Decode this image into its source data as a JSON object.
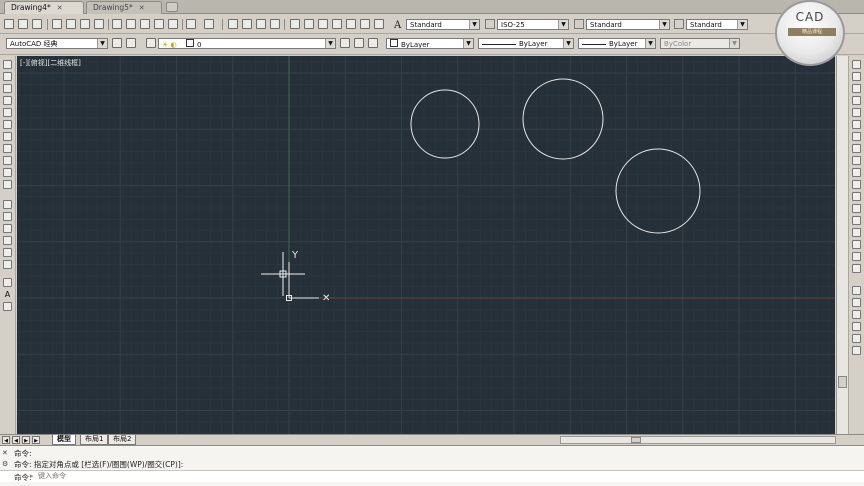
{
  "tabs": [
    {
      "label": "Drawing4*",
      "active": true
    },
    {
      "label": "Drawing5*",
      "active": false
    }
  ],
  "styles": {
    "text_style": "Standard",
    "dim_style": "ISO-25",
    "table_style": "Standard",
    "multileader_style": "Standard"
  },
  "workspace": {
    "value": "AutoCAD 经典"
  },
  "layer": {
    "value": "0"
  },
  "properties": {
    "color": "ByLayer",
    "linetype": "ByLayer",
    "lineweight": "ByLayer",
    "plotstyle": "ByColor"
  },
  "viewport_label": "[-][俯视][二维线框]",
  "ucs": {
    "x_label": "X",
    "y_label": "Y"
  },
  "layout_tabs": [
    {
      "label": "模型",
      "active": true
    },
    {
      "label": "布局1",
      "active": false
    },
    {
      "label": "布局2",
      "active": false
    }
  ],
  "command": {
    "history": [
      "命令:",
      "命令: 指定对角点或 [栏选(F)/圈围(WP)/圈交(CP)]:"
    ],
    "prompt_prefix": "命令:",
    "input_placeholder": "键入命令"
  },
  "logo": {
    "title": "CAD",
    "subtitle": "精品课程"
  },
  "colors": {
    "canvas": "#263039",
    "grid_major": "#344049",
    "grid_minor": "#2c3740",
    "x_axis": "#7a3a3a",
    "y_axis": "#3a6a55",
    "circle": "#e6e6e6"
  }
}
